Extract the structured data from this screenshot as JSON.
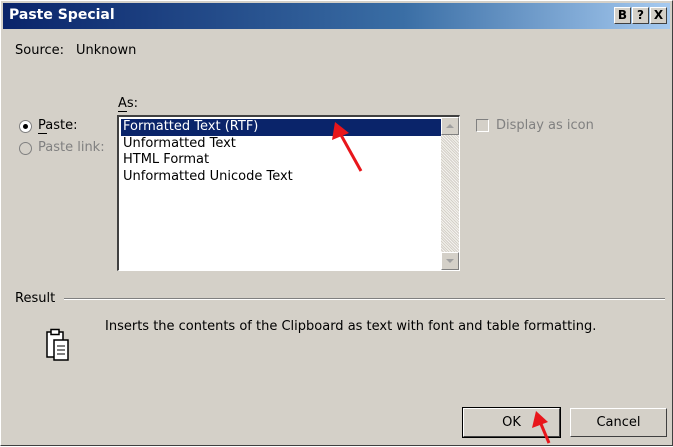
{
  "window": {
    "title": "Paste Special",
    "buttons": {
      "move_label": "B",
      "help_label": "?",
      "close_label": "X"
    }
  },
  "source": {
    "label": "Source:",
    "value": "Unknown"
  },
  "paste_options": {
    "paste_label": "Paste:",
    "paste_link_label": "Paste link:",
    "selected": "paste"
  },
  "as_list": {
    "label": "As:",
    "items": [
      {
        "label": "Formatted Text (RTF)",
        "selected": true
      },
      {
        "label": "Unformatted Text",
        "selected": false
      },
      {
        "label": "HTML Format",
        "selected": false
      },
      {
        "label": "Unformatted Unicode Text",
        "selected": false
      }
    ]
  },
  "display_as_icon": {
    "label": "Display as icon",
    "checked": false,
    "enabled": false
  },
  "result": {
    "label": "Result",
    "text": "Inserts the contents of the Clipboard as text with font and table formatting."
  },
  "buttons": {
    "ok_label": "OK",
    "cancel_label": "Cancel"
  },
  "colors": {
    "dialog_bg": "#d4d0c8",
    "title_bar": "#0a246a",
    "selection": "#0a246a",
    "annotation_arrow": "#e8161b"
  },
  "icons": {
    "paste_result": "clipboard-icon",
    "scroll_up": "scroll-up-arrow-icon",
    "scroll_down": "scroll-down-arrow-icon"
  }
}
